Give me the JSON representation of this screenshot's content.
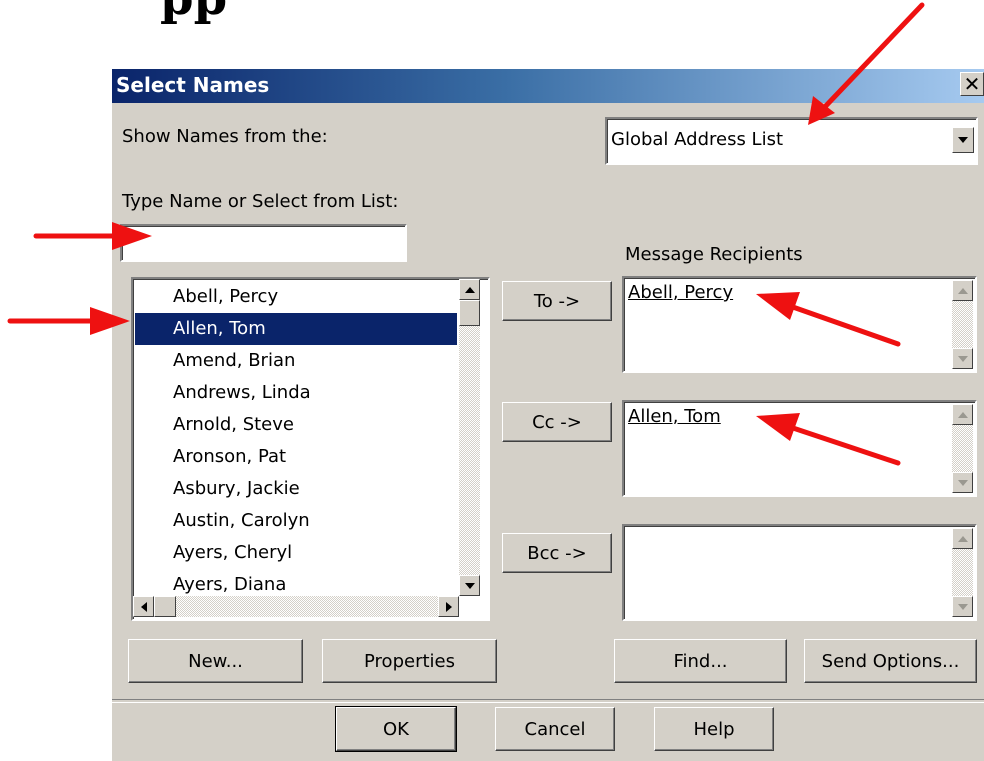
{
  "page_heading_fragment": "pp",
  "dialog": {
    "title": "Select Names",
    "close_symbol": "✕",
    "show_names_label": "Show Names from the:",
    "address_book": "Global Address List",
    "type_name_label": "Type Name or Select from List:",
    "type_name_value": "",
    "names": [
      "Abell, Percy",
      "Allen, Tom",
      "Amend, Brian",
      "Andrews, Linda",
      "Arnold, Steve",
      "Aronson, Pat",
      "Asbury, Jackie",
      "Austin, Carolyn",
      "Ayers, Cheryl",
      "Ayers, Diana"
    ],
    "selected_name": "Allen, Tom",
    "message_recipients_label": "Message Recipients",
    "to_button": "To ->",
    "cc_button": "Cc ->",
    "bcc_button": "Bcc ->",
    "to_recipient": "Abell, Percy",
    "cc_recipient": "Allen, Tom",
    "bcc_recipient": "",
    "new_button": "New...",
    "properties_button": "Properties",
    "find_button": "Find...",
    "send_options_button": "Send Options...",
    "ok_button": "OK",
    "cancel_button": "Cancel",
    "help_button": "Help"
  },
  "colors": {
    "title_gradient_start": "#0a246a",
    "title_gradient_end": "#a6caf0",
    "dialog_face": "#d4d0c8",
    "selection": "#0a246a",
    "annotation_arrow": "#ee1111"
  },
  "icons": {
    "close": "close-icon",
    "dropdown": "chevron-down-icon",
    "scroll_up": "scroll-up-icon",
    "scroll_down": "scroll-down-icon",
    "scroll_left": "scroll-left-icon",
    "scroll_right": "scroll-right-icon",
    "annotation": "red-arrow-icon"
  }
}
